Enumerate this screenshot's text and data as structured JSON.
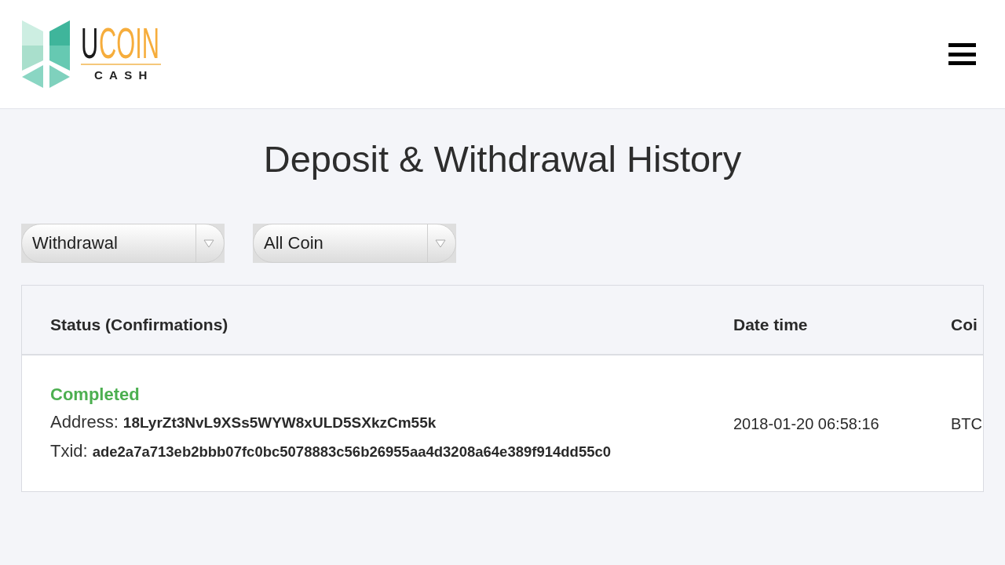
{
  "header": {
    "logo": {
      "letter": "U",
      "word": "COIN",
      "tagline": "CASH"
    }
  },
  "page": {
    "title": "Deposit & Withdrawal History"
  },
  "filters": [
    {
      "value": "Withdrawal"
    },
    {
      "value": "All Coin"
    }
  ],
  "table": {
    "columns": [
      "Status (Confirmations)",
      "Date time",
      "Coi"
    ],
    "rows": [
      {
        "status": "Completed",
        "color": "#4caf50",
        "address_label": "Address:",
        "address": "18LyrZt3NvL9XSs5WYW8xULD5SXkzCm55k",
        "txid_label": "Txid:",
        "txid": "ade2a7a713eb2bbb07fc0bc5078883c56b26955aa4d3208a64e389f914dd55c0",
        "date_time": "2018-01-20 06:58:16",
        "coin": "BTC"
      }
    ]
  }
}
